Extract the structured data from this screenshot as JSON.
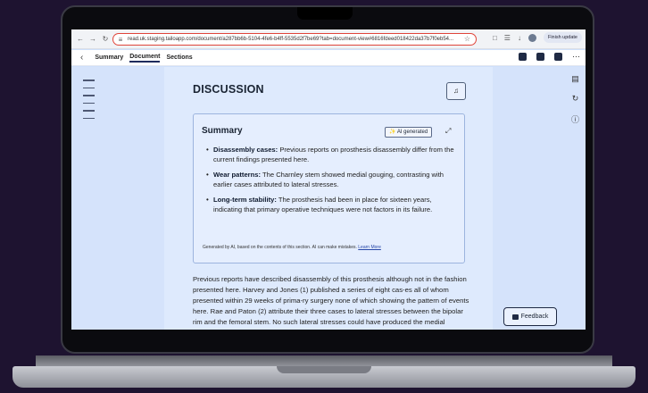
{
  "browser": {
    "url": "read.uk.staging.tailoapp.com/document/a287bb6b-5104-4fe6-b4ff-5535d2f7be69?tab=document-view#6816fdeed018422da37b7f0eb54...",
    "finish_update_label": "Finish update"
  },
  "header": {
    "tabs": [
      {
        "label": "Summary"
      },
      {
        "label": "Document"
      },
      {
        "label": "Sections"
      }
    ]
  },
  "document": {
    "section_title": "DISCUSSION",
    "summary": {
      "title": "Summary",
      "ai_badge": "AI generated",
      "bullets": [
        {
          "term": "Disassembly cases:",
          "text": " Previous reports on prosthesis disassembly differ from the current findings presented here."
        },
        {
          "term": "Wear patterns:",
          "text": " The Charnley stem showed medial gouging, contrasting with earlier cases attributed to lateral stresses."
        },
        {
          "term": "Long-term stability:",
          "text": " The prosthesis had been in place for sixteen years, indicating that primary operative techniques were not factors in its failure."
        }
      ],
      "footnote": "Generated by AI, based on the contents of this section. AI can make mistakes.",
      "learn_more": "Learn More"
    },
    "body_text": "Previous reports have described disassembly of this prosthesis although not in the fashion presented here. Harvey and Jones (1) published a series of eight cas-es all of whom presented within 29 weeks of prima-ry surgery none of which showing the pattern of events here. Rae and Paton (2) attribute their three cases to lateral stresses between the bipolar rim and the femoral stem. No such lateral stresses could have produced the medial"
  },
  "feedback_label": "Feedback",
  "colors": {
    "accent_outline": "#e0453a",
    "page_bg": "#deeafd",
    "dark_ui": "#1f2a44"
  }
}
